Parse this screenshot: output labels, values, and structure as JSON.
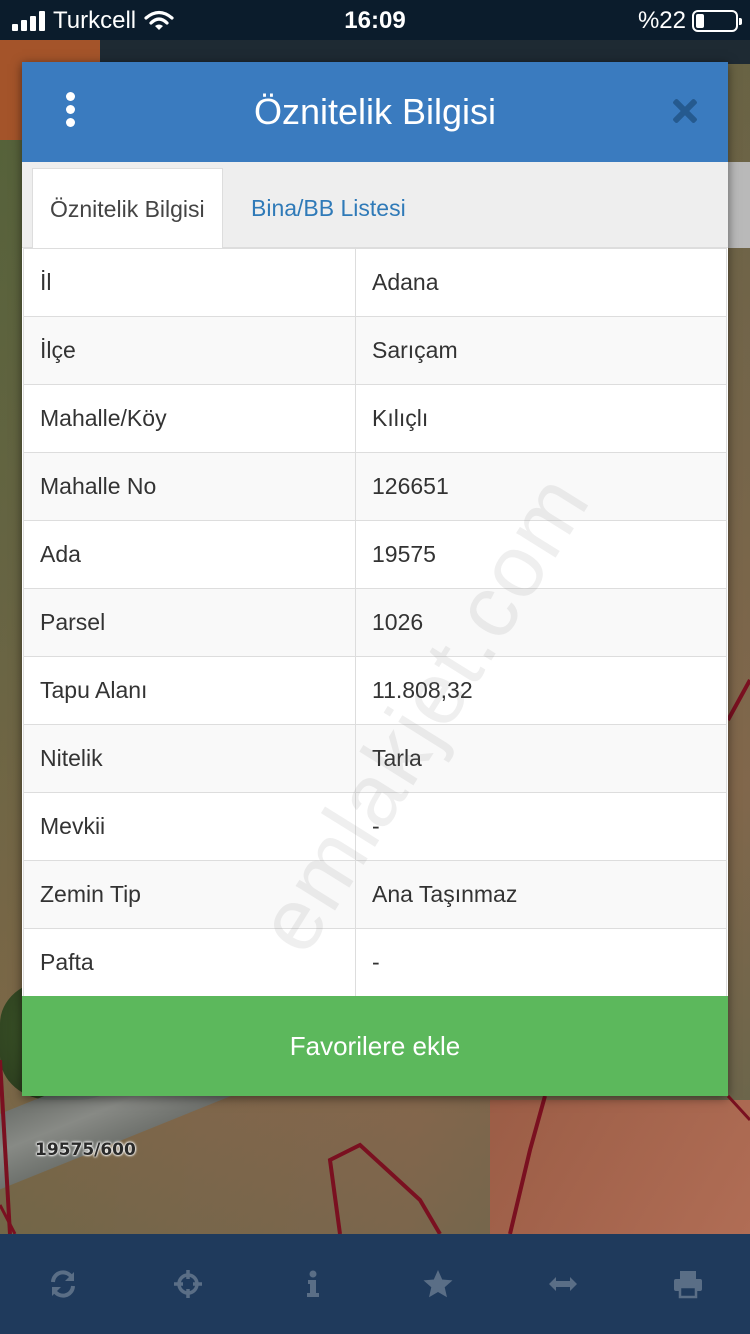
{
  "status_bar": {
    "carrier": "Turkcell",
    "time": "16:09",
    "battery": "%22",
    "battery_level": 0.22
  },
  "map": {
    "parcel_label": "19575/600"
  },
  "modal": {
    "title": "Öznitelik Bilgisi",
    "tabs": [
      {
        "label": "Öznitelik Bilgisi",
        "active": true
      },
      {
        "label": "Bina/BB Listesi",
        "active": false
      }
    ],
    "rows": [
      {
        "key": "İl",
        "value": "Adana"
      },
      {
        "key": "İlçe",
        "value": "Sarıçam"
      },
      {
        "key": "Mahalle/Köy",
        "value": "Kılıçlı"
      },
      {
        "key": "Mahalle No",
        "value": "126651"
      },
      {
        "key": "Ada",
        "value": "19575"
      },
      {
        "key": "Parsel",
        "value": "1026"
      },
      {
        "key": "Tapu Alanı",
        "value": "11.808,32"
      },
      {
        "key": "Nitelik",
        "value": "Tarla"
      },
      {
        "key": "Mevkii",
        "value": "-"
      },
      {
        "key": "Zemin Tip",
        "value": "Ana Taşınmaz"
      },
      {
        "key": "Pafta",
        "value": "-"
      }
    ],
    "favorite_button": "Favorilere ekle",
    "watermark": "emlakjet.com"
  },
  "toolbar": {
    "items": [
      {
        "icon": "refresh-icon"
      },
      {
        "icon": "crosshair-icon"
      },
      {
        "icon": "info-icon"
      },
      {
        "icon": "star-icon"
      },
      {
        "icon": "measure-icon"
      },
      {
        "icon": "print-icon"
      }
    ]
  },
  "colors": {
    "header": "#3a7bbf",
    "button": "#5cb85c",
    "toolbar": "#1f3a5c",
    "tab_link": "#2f7ab8"
  }
}
